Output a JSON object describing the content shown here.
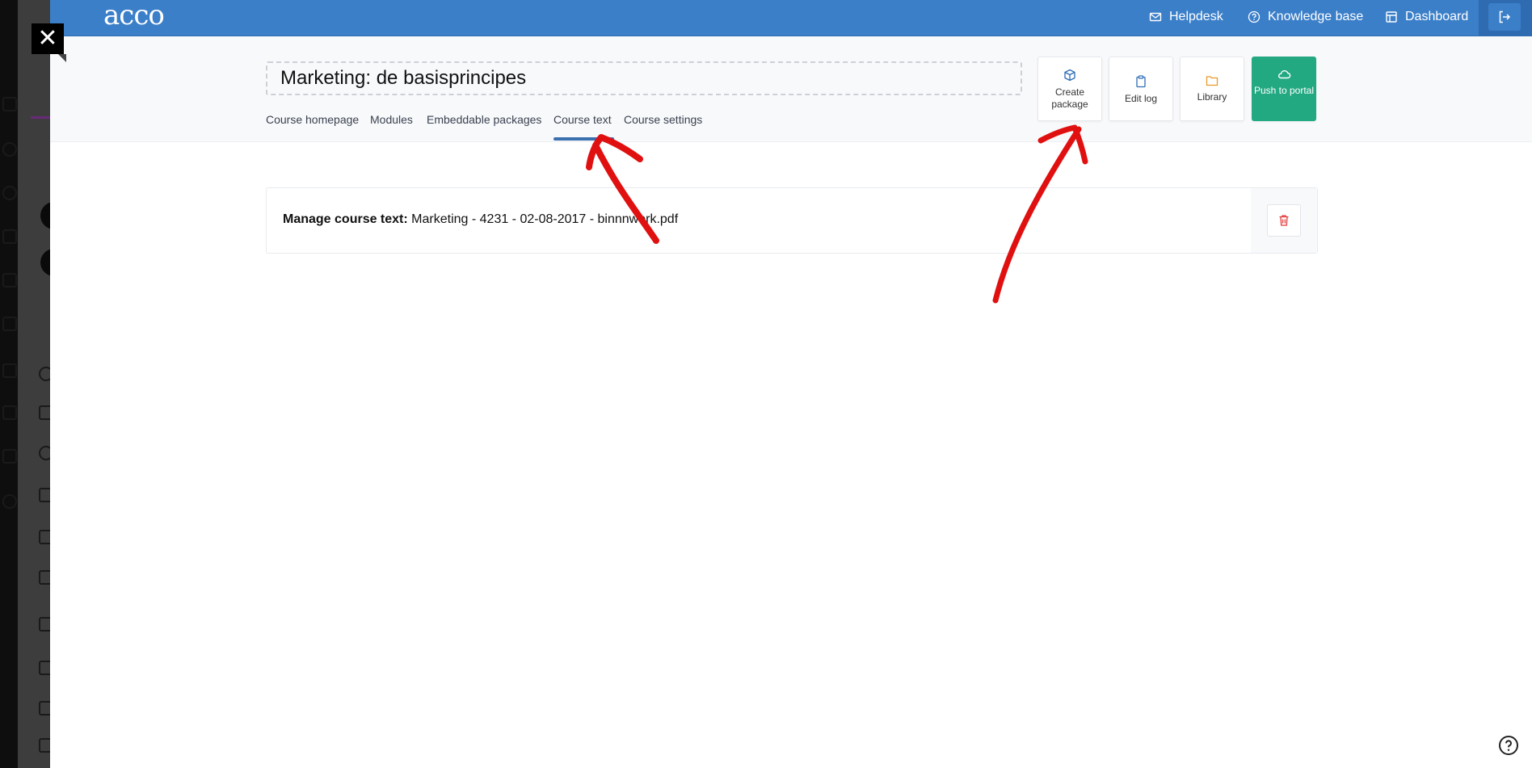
{
  "topbar": {
    "logo": "acco",
    "helpdesk": "Helpdesk",
    "knowledge_base": "Knowledge base",
    "dashboard": "Dashboard"
  },
  "course": {
    "title": "Marketing: de basisprincipes"
  },
  "tabs": [
    {
      "label": "Course homepage",
      "active": false
    },
    {
      "label": "Modules",
      "active": false
    },
    {
      "label": "Embeddable packages",
      "active": false
    },
    {
      "label": "Course text",
      "active": true
    },
    {
      "label": "Course settings",
      "active": false
    }
  ],
  "actions": {
    "create_package": "Create package",
    "edit_log": "Edit log",
    "library": "Library",
    "push_to_portal": "Push to portal"
  },
  "course_text": {
    "label": "Manage course text:",
    "value": "Marketing - 4231 - 02-08-2017 - binnnwerk.pdf"
  },
  "colors": {
    "topbar": "#3b7fc9",
    "push_button": "#23a982",
    "active_tab_underline": "#3a6fb0",
    "annotation_arrow": "#e01010",
    "delete_icon": "#e03c3c",
    "library_icon": "#e89a2c"
  },
  "icons": {
    "helpdesk": "mail-icon",
    "knowledge_base": "question-circle-icon",
    "dashboard": "layout-icon",
    "logout": "logout-icon",
    "create_package": "cube-icon",
    "edit_log": "clipboard-icon",
    "library": "folder-icon",
    "push_to_portal": "cloud-icon",
    "delete": "trash-icon",
    "help": "help-circle-icon",
    "close": "close-icon"
  }
}
